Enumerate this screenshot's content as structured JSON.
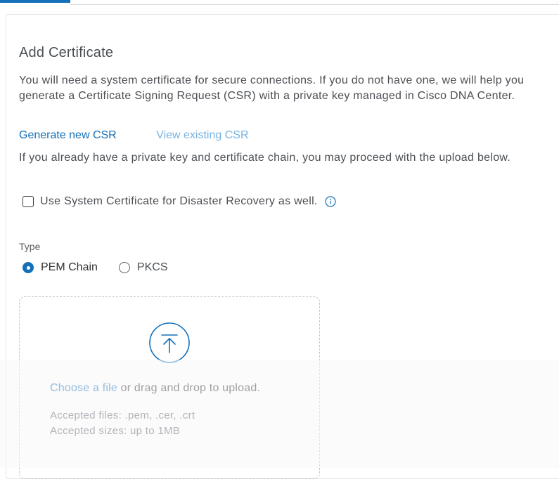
{
  "add_certificate": {
    "title": "Add Certificate",
    "intro": "You will need a system certificate for secure connections. If you do not have one, we will help you generate a Certificate Signing Request (CSR) with a private key managed in Cisco DNA Center.",
    "links": {
      "generate_csr": "Generate new CSR",
      "view_csr": "View existing CSR"
    },
    "upload_note": "If you already have a private key and certificate chain, you may proceed with the upload below.",
    "disaster_recovery": {
      "label": "Use System Certificate for Disaster Recovery as well.",
      "checked": false
    },
    "type": {
      "label": "Type",
      "options": [
        "PEM Chain",
        "PKCS"
      ],
      "selected": "PEM Chain"
    },
    "upload": {
      "choose_link": "Choose a file",
      "choose_rest": " or drag and drop to upload.",
      "accepted_files": "Accepted files: .pem, .cer, .crt",
      "accepted_sizes": "Accepted sizes: up to 1MB"
    }
  },
  "colors": {
    "accent": "#1570b8",
    "link_muted": "#79b3e0",
    "text": "#4b4f54"
  },
  "icons": {
    "info": "info-icon",
    "upload": "upload-arrow-icon"
  }
}
